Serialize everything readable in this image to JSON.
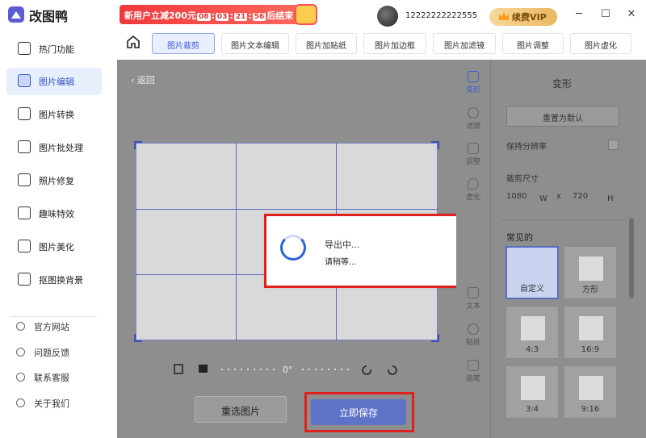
{
  "header": {
    "app_title": "改图鸭",
    "promo_text": "新用户立减200元",
    "countdown": [
      "08",
      "03",
      "21",
      "56"
    ],
    "promo_suffix": "后结束",
    "username": "12222222222555",
    "vip_label": "续费VIP"
  },
  "sidebar": {
    "items": [
      {
        "label": "热门功能"
      },
      {
        "label": "图片编辑"
      },
      {
        "label": "图片转换"
      },
      {
        "label": "图片批处理"
      },
      {
        "label": "照片修复"
      },
      {
        "label": "趣味特效"
      },
      {
        "label": "图片美化"
      },
      {
        "label": "抠图换背景"
      }
    ],
    "links": [
      {
        "label": "官方网站"
      },
      {
        "label": "问题反馈"
      },
      {
        "label": "联系客服"
      },
      {
        "label": "关于我们"
      }
    ]
  },
  "toolbar": {
    "tabs": [
      "图片裁剪",
      "图片文本编辑",
      "图片加贴纸",
      "图片加边框",
      "图片加滤镜",
      "图片调整",
      "图片虚化"
    ]
  },
  "editor": {
    "back_label": "返回",
    "rotation": "0°",
    "reselect_label": "重选图片",
    "save_label": "立即保存"
  },
  "dialog": {
    "title": "导出中...",
    "subtitle": "请稍等..."
  },
  "tool_column": [
    "变形",
    "滤镜",
    "调整",
    "虚化",
    "文本",
    "贴纸",
    "画笔"
  ],
  "panel": {
    "title": "变形",
    "reset_label": "重置为默认",
    "keep_ratio_label": "保持分辨率",
    "crop_size_label": "裁剪尺寸",
    "width": "1080",
    "width_unit": "W",
    "x_sep": "x",
    "height": "720",
    "height_unit": "H",
    "common_label": "常见的",
    "presets": [
      "自定义",
      "方形",
      "4:3",
      "16:9",
      "3:4",
      "9:16"
    ]
  }
}
